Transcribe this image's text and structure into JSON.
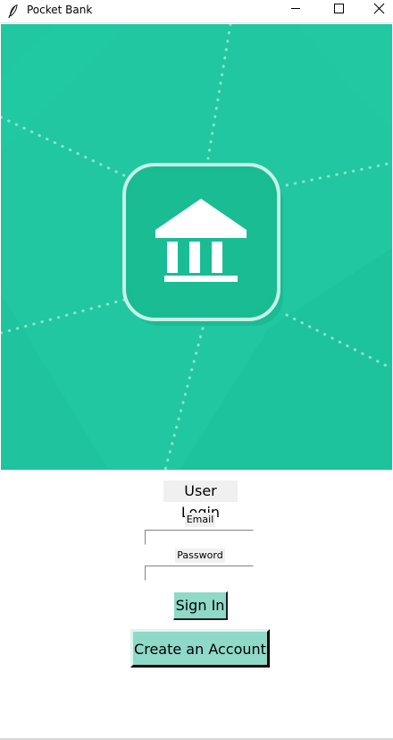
{
  "window": {
    "title": "Pocket Bank",
    "controls": [
      "minimize",
      "maximize",
      "close"
    ]
  },
  "banner": {
    "icon": "bank-building-icon",
    "background_color": "#20c7a1",
    "tile_color": "#19bb93",
    "dot_color": "#8fe3cd"
  },
  "login": {
    "heading": "User Login",
    "email_label": "Email",
    "email_value": "",
    "password_label": "Password",
    "password_value": "",
    "signin_label": "Sign In",
    "create_label": "Create an Account",
    "button_color": "#8fd9c9"
  }
}
